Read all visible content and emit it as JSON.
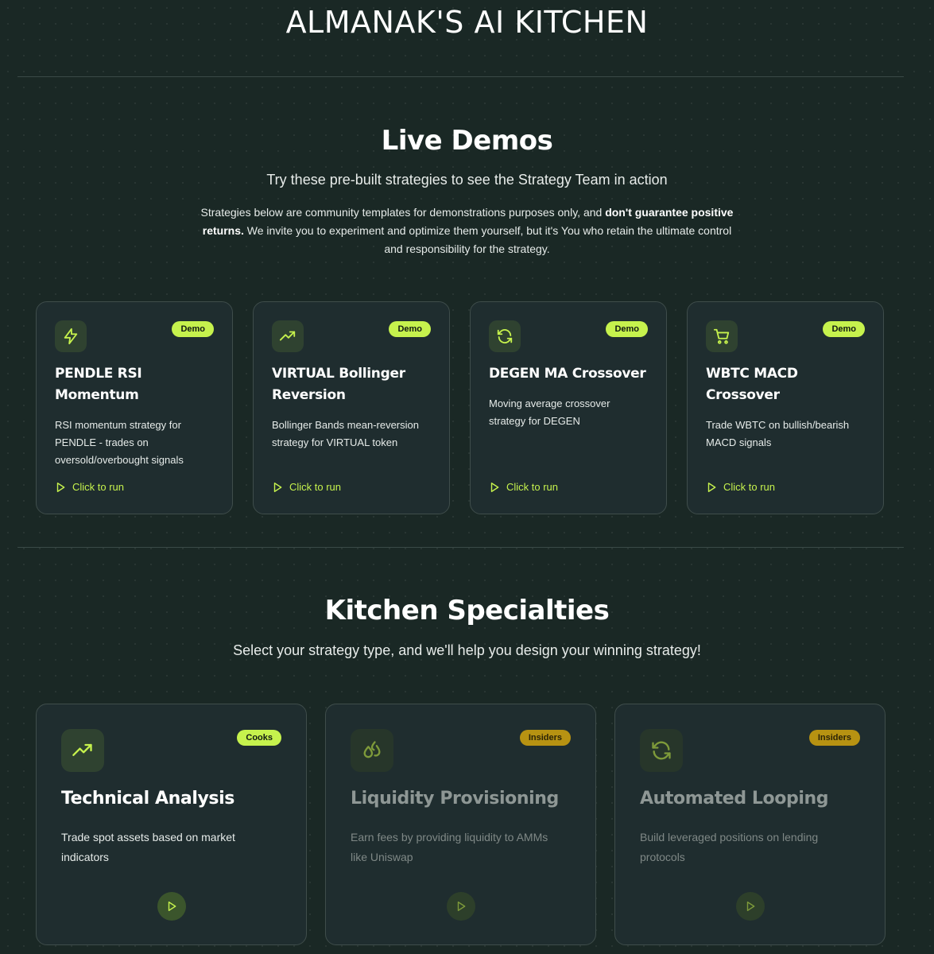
{
  "header": {
    "title": "ALMANAK'S AI KITCHEN"
  },
  "live_demos": {
    "title": "Live Demos",
    "subtitle": "Try these pre-built strategies to see the Strategy Team in action",
    "disclaimer": {
      "part1": "Strategies below are community templates for demonstrations purposes only, and ",
      "bold": "don't guarantee positive returns.",
      "part2": " We invite you to experiment and optimize them yourself, but it's You who retain the ultimate control and responsibility for the strategy."
    },
    "cards": [
      {
        "icon": "lightning-icon",
        "badge": "Demo",
        "title": "PENDLE RSI Momentum",
        "description": "RSI momentum strategy for PENDLE - trades on oversold/overbought signals",
        "action": "Click to run"
      },
      {
        "icon": "trending-up-icon",
        "badge": "Demo",
        "title": "VIRTUAL Bollinger Reversion",
        "description": "Bollinger Bands mean-reversion strategy for VIRTUAL token",
        "action": "Click to run"
      },
      {
        "icon": "refresh-icon",
        "badge": "Demo",
        "title": "DEGEN MA Crossover",
        "description": "Moving average crossover strategy for DEGEN",
        "action": "Click to run"
      },
      {
        "icon": "cart-icon",
        "badge": "Demo",
        "title": "WBTC MACD Crossover",
        "description": "Trade WBTC on bullish/bearish MACD signals",
        "action": "Click to run"
      }
    ]
  },
  "kitchen_specialties": {
    "title": "Kitchen Specialties",
    "subtitle": "Select your strategy type, and we'll help you design your winning strategy!",
    "cards": [
      {
        "icon": "trending-up-icon",
        "badge": "Cooks",
        "title": "Technical Analysis",
        "description": "Trade spot assets based on market indicators"
      },
      {
        "icon": "droplets-icon",
        "badge": "Insiders",
        "title": "Liquidity Provisioning",
        "description": "Earn fees by providing liquidity to AMMs like Uniswap"
      },
      {
        "icon": "refresh-icon",
        "badge": "Insiders",
        "title": "Automated Looping",
        "description": "Build leveraged positions on lending protocols"
      }
    ]
  },
  "colors": {
    "background": "#1a2825",
    "card": "#1f2d2f",
    "accent": "#c6f24d",
    "insiders_badge": "#b79212"
  }
}
